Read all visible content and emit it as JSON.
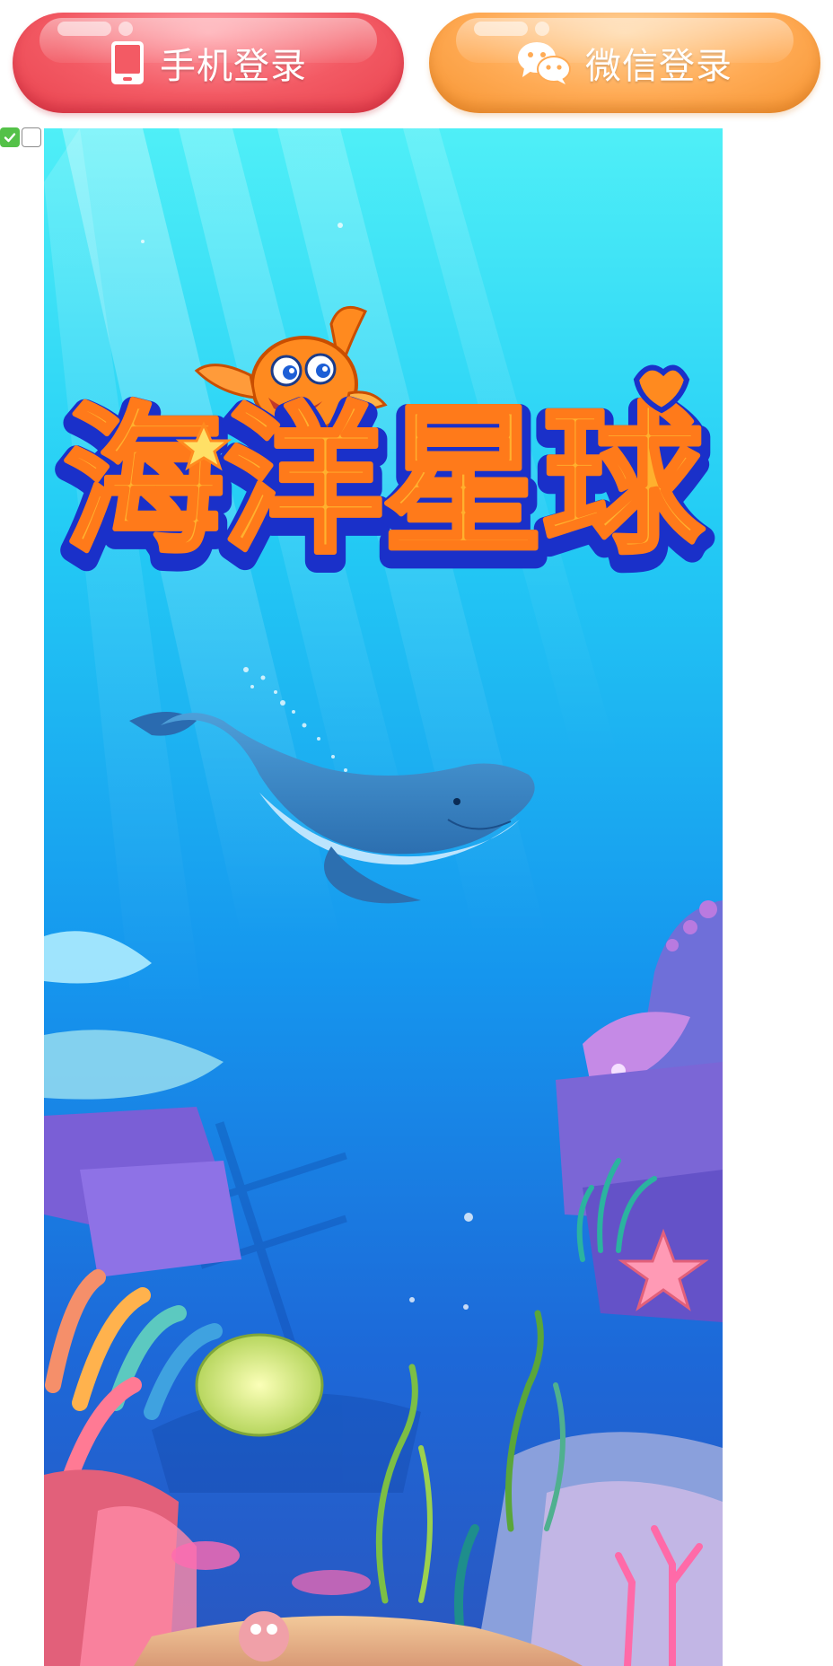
{
  "login": {
    "phone_label": "手机登录",
    "wechat_label": "微信登录",
    "phone_icon": "phone-icon",
    "wechat_icon": "wechat-icon"
  },
  "agreement": {
    "checked_state": true
  },
  "splash": {
    "logo_text": "海洋星球",
    "colors": {
      "phone_button": "#f35a64",
      "wechat_button": "#ffab55",
      "ocean_top": "#46e8f5",
      "ocean_bottom": "#1f6fe0"
    }
  }
}
